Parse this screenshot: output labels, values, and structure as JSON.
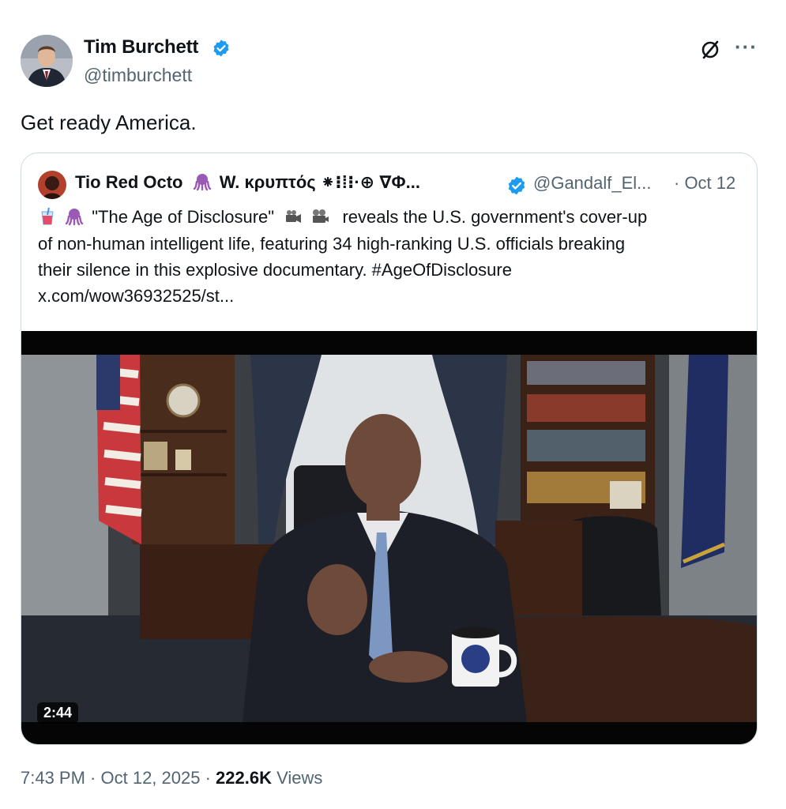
{
  "author": {
    "name": "Tim Burchett",
    "handle": "@timburchett",
    "verified": true,
    "badge_color": "#1d9bf0"
  },
  "tweet": {
    "text": "Get ready America."
  },
  "header_actions": {
    "grok_icon": "grok-slash-circle-icon",
    "more_label": "···"
  },
  "quote": {
    "name": "Tio Red Octo",
    "name_rest": "W. κρυπτός ⁕⁝⁞⁝·⊕ ∇Φ...",
    "handle": "@Gandalf_El...",
    "date": "· Oct 12",
    "line1_text": "\"The Age of Disclosure\"",
    "line1_rest": "reveals the U.S. government's cover-up",
    "line2": "of non-human intelligent life, featuring 34 high-ranking U.S. officials breaking",
    "line3": "their silence in this explosive documentary. #AgeOfDisclosure",
    "line4": "x.com/wow36932525/st...",
    "video": {
      "duration": "2:44"
    }
  },
  "meta": {
    "time": "7:43 PM",
    "sep1": " · ",
    "date": "Oct 12, 2025",
    "sep2": " · ",
    "views_count": "222.6K",
    "views_label": " Views"
  }
}
